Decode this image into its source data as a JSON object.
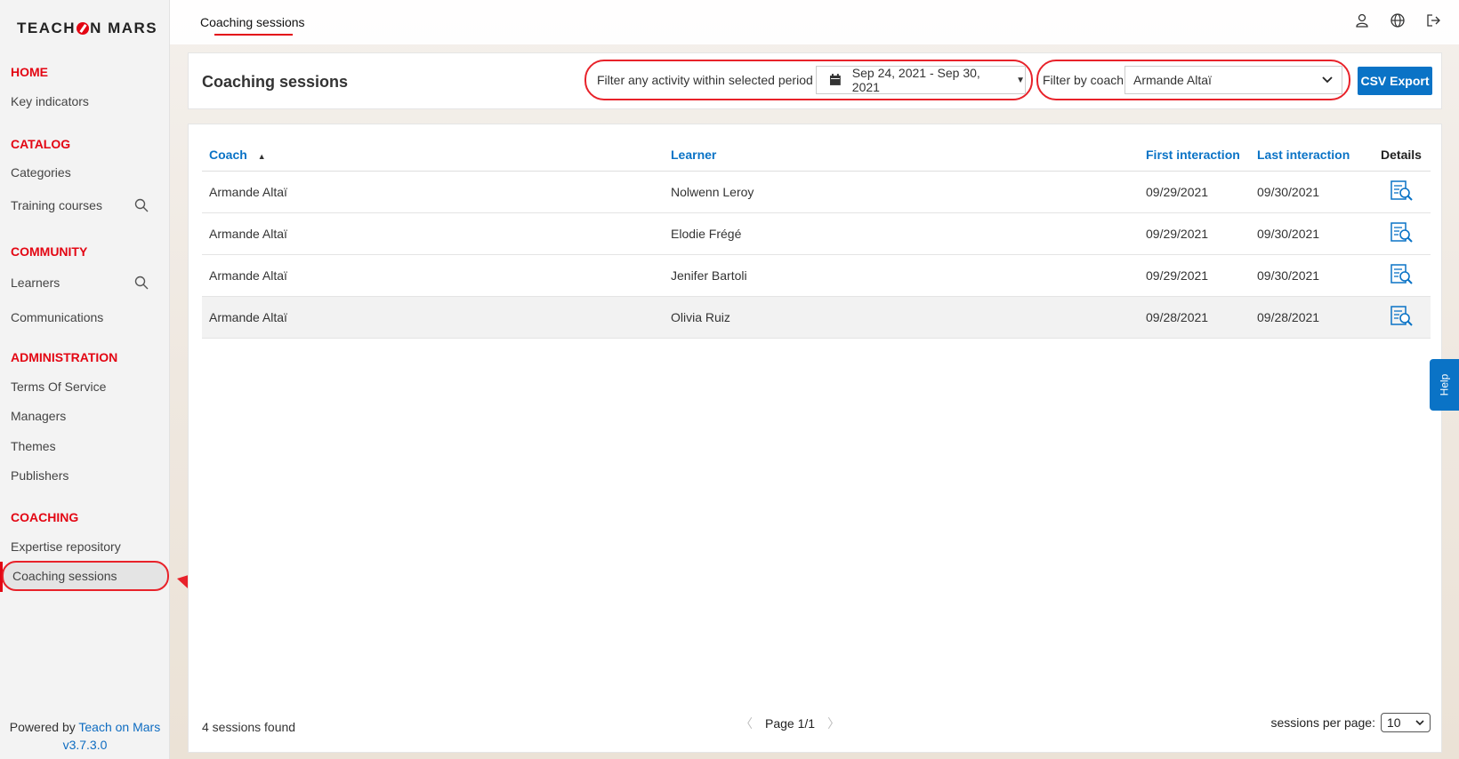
{
  "brand": {
    "logo_left": "TEACH",
    "logo_right": "N MARS"
  },
  "sidebar": {
    "sections": [
      {
        "title": "HOME",
        "items": [
          "Key indicators"
        ]
      },
      {
        "title": "CATALOG",
        "items": [
          "Categories",
          "Training courses"
        ]
      },
      {
        "title": "COMMUNITY",
        "items": [
          "Learners",
          "Communications"
        ]
      },
      {
        "title": "ADMINISTRATION",
        "items": [
          "Terms Of Service",
          "Managers",
          "Themes",
          "Publishers"
        ]
      },
      {
        "title": "COACHING",
        "items": [
          "Expertise repository",
          "Coaching sessions"
        ]
      }
    ],
    "active_item": "Coaching sessions",
    "powered_by_prefix": "Powered by",
    "powered_by_link": "Teach on Mars",
    "version": "v3.7.3.0"
  },
  "topbar": {
    "tab": "Coaching sessions",
    "icons": [
      "user-icon",
      "globe-icon",
      "logout-icon"
    ]
  },
  "header": {
    "title": "Coaching sessions",
    "period_label": "Filter any activity within selected period",
    "period_value": "Sep 24, 2021 - Sep 30, 2021",
    "coach_label": "Filter by coach",
    "coach_value": "Armande Altaï",
    "csv_button": "CSV Export"
  },
  "table": {
    "columns": [
      "Coach",
      "Learner",
      "First interaction",
      "Last interaction",
      "Details"
    ],
    "rows": [
      {
        "coach": "Armande Altaï",
        "learner": "Nolwenn Leroy",
        "first": "09/29/2021",
        "last": "09/30/2021"
      },
      {
        "coach": "Armande Altaï",
        "learner": "Elodie Frégé",
        "first": "09/29/2021",
        "last": "09/30/2021"
      },
      {
        "coach": "Armande Altaï",
        "learner": "Jenifer Bartoli",
        "first": "09/29/2021",
        "last": "09/30/2021"
      },
      {
        "coach": "Armande Altaï",
        "learner": "Olivia Ruiz",
        "first": "09/28/2021",
        "last": "09/28/2021"
      }
    ]
  },
  "footer": {
    "sessions_found": "4 sessions found",
    "page": "Page 1/1",
    "per_page_label": "sessions per page:",
    "per_page_value": "10"
  },
  "help_tab": "Help",
  "colors": {
    "accent_red": "#e30613",
    "brand_blue": "#0a73c6"
  }
}
